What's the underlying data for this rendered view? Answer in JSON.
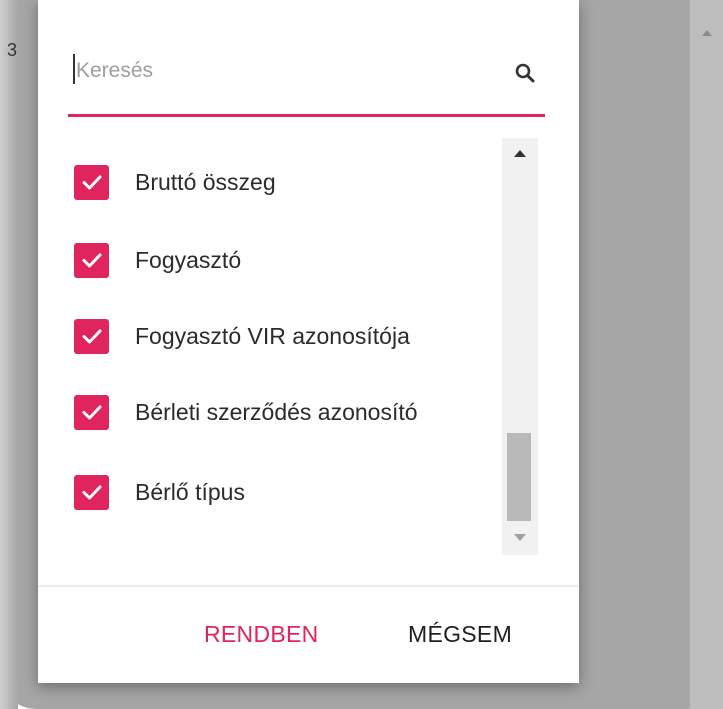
{
  "background": {
    "row_number": "3"
  },
  "dialog": {
    "search": {
      "placeholder": "Keresés",
      "value": ""
    },
    "items": [
      {
        "label": "Bruttó összeg",
        "checked": true
      },
      {
        "label": "Fogyasztó",
        "checked": true
      },
      {
        "label": "Fogyasztó VIR azonosítója",
        "checked": true
      },
      {
        "label": "Bérleti szerződés azonosító",
        "checked": true
      },
      {
        "label": "Bérlő típus",
        "checked": true
      }
    ],
    "buttons": {
      "ok": "RENDBEN",
      "cancel": "MÉGSEM"
    }
  },
  "colors": {
    "accent": "#e0245e",
    "backdrop": "#a6a6a6"
  }
}
